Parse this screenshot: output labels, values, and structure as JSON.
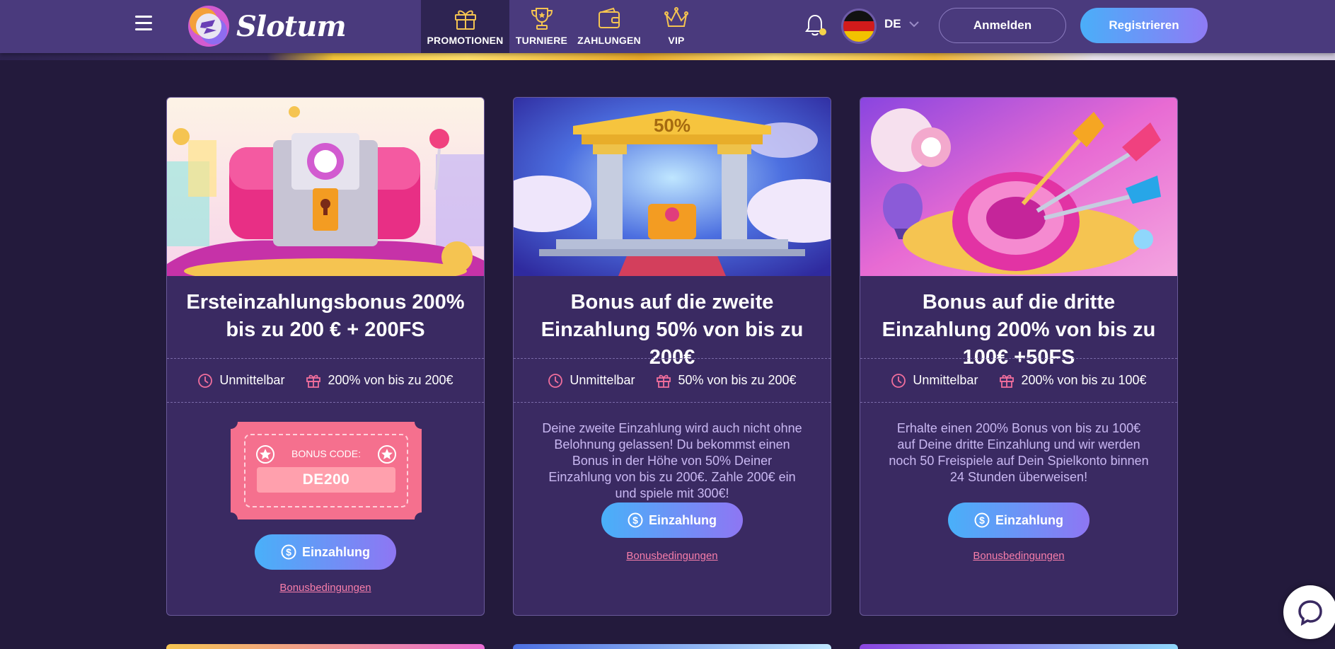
{
  "header": {
    "brand": "Slotum",
    "nav": [
      {
        "label": "PROMOTIONEN",
        "icon": "gift-icon",
        "active": true
      },
      {
        "label": "TURNIERE",
        "icon": "trophy-icon",
        "active": false
      },
      {
        "label": "ZAHLUNGEN",
        "icon": "wallet-icon",
        "active": false
      },
      {
        "label": "VIP",
        "icon": "crown-icon",
        "active": false
      }
    ],
    "language": "DE",
    "login_label": "Anmelden",
    "register_label": "Registrieren"
  },
  "cards": [
    {
      "title": "Ersteinzahlungsbonus 200% bis zu 200 € + 200FS",
      "timing": "Unmittelbar",
      "bonus": "200% von bis zu 200€",
      "coupon_label": "BONUS CODE:",
      "coupon_code": "DE200",
      "deposit_label": "Einzahlung",
      "terms_label": "Bonusbedingungen"
    },
    {
      "title": "Bonus auf die zweite Einzahlung 50% von bis zu 200€",
      "timing": "Unmittelbar",
      "bonus": "50% von bis zu 200€",
      "description": "Deine zweite Einzahlung wird auch nicht ohne Belohnung gelassen! Du bekommst einen Bonus in der Höhe von 50% Deiner Einzahlung von bis zu 200€. Zahle 200€ ein und spiele mit 300€!",
      "image_text": "50%",
      "deposit_label": "Einzahlung",
      "terms_label": "Bonusbedingungen"
    },
    {
      "title": "Bonus auf die dritte Einzahlung 200% von bis zu 100€ +50FS",
      "timing": "Unmittelbar",
      "bonus": "200% von bis zu 100€",
      "description": "Erhalte einen 200% Bonus von bis zu 100€ auf Deine dritte Einzahlung und wir werden noch 50 Freispiele auf Dein Spielkonto binnen 24 Stunden überweisen!",
      "deposit_label": "Einzahlung",
      "terms_label": "Bonusbedingungen"
    }
  ],
  "colors": {
    "header_bg": "#4a3a7d",
    "page_bg": "#231a3c",
    "card_bg": "#3a2a62",
    "accent_gradient_start": "#49b0f9",
    "accent_gradient_end": "#8e76f3",
    "link_pink": "#f77eaa"
  }
}
